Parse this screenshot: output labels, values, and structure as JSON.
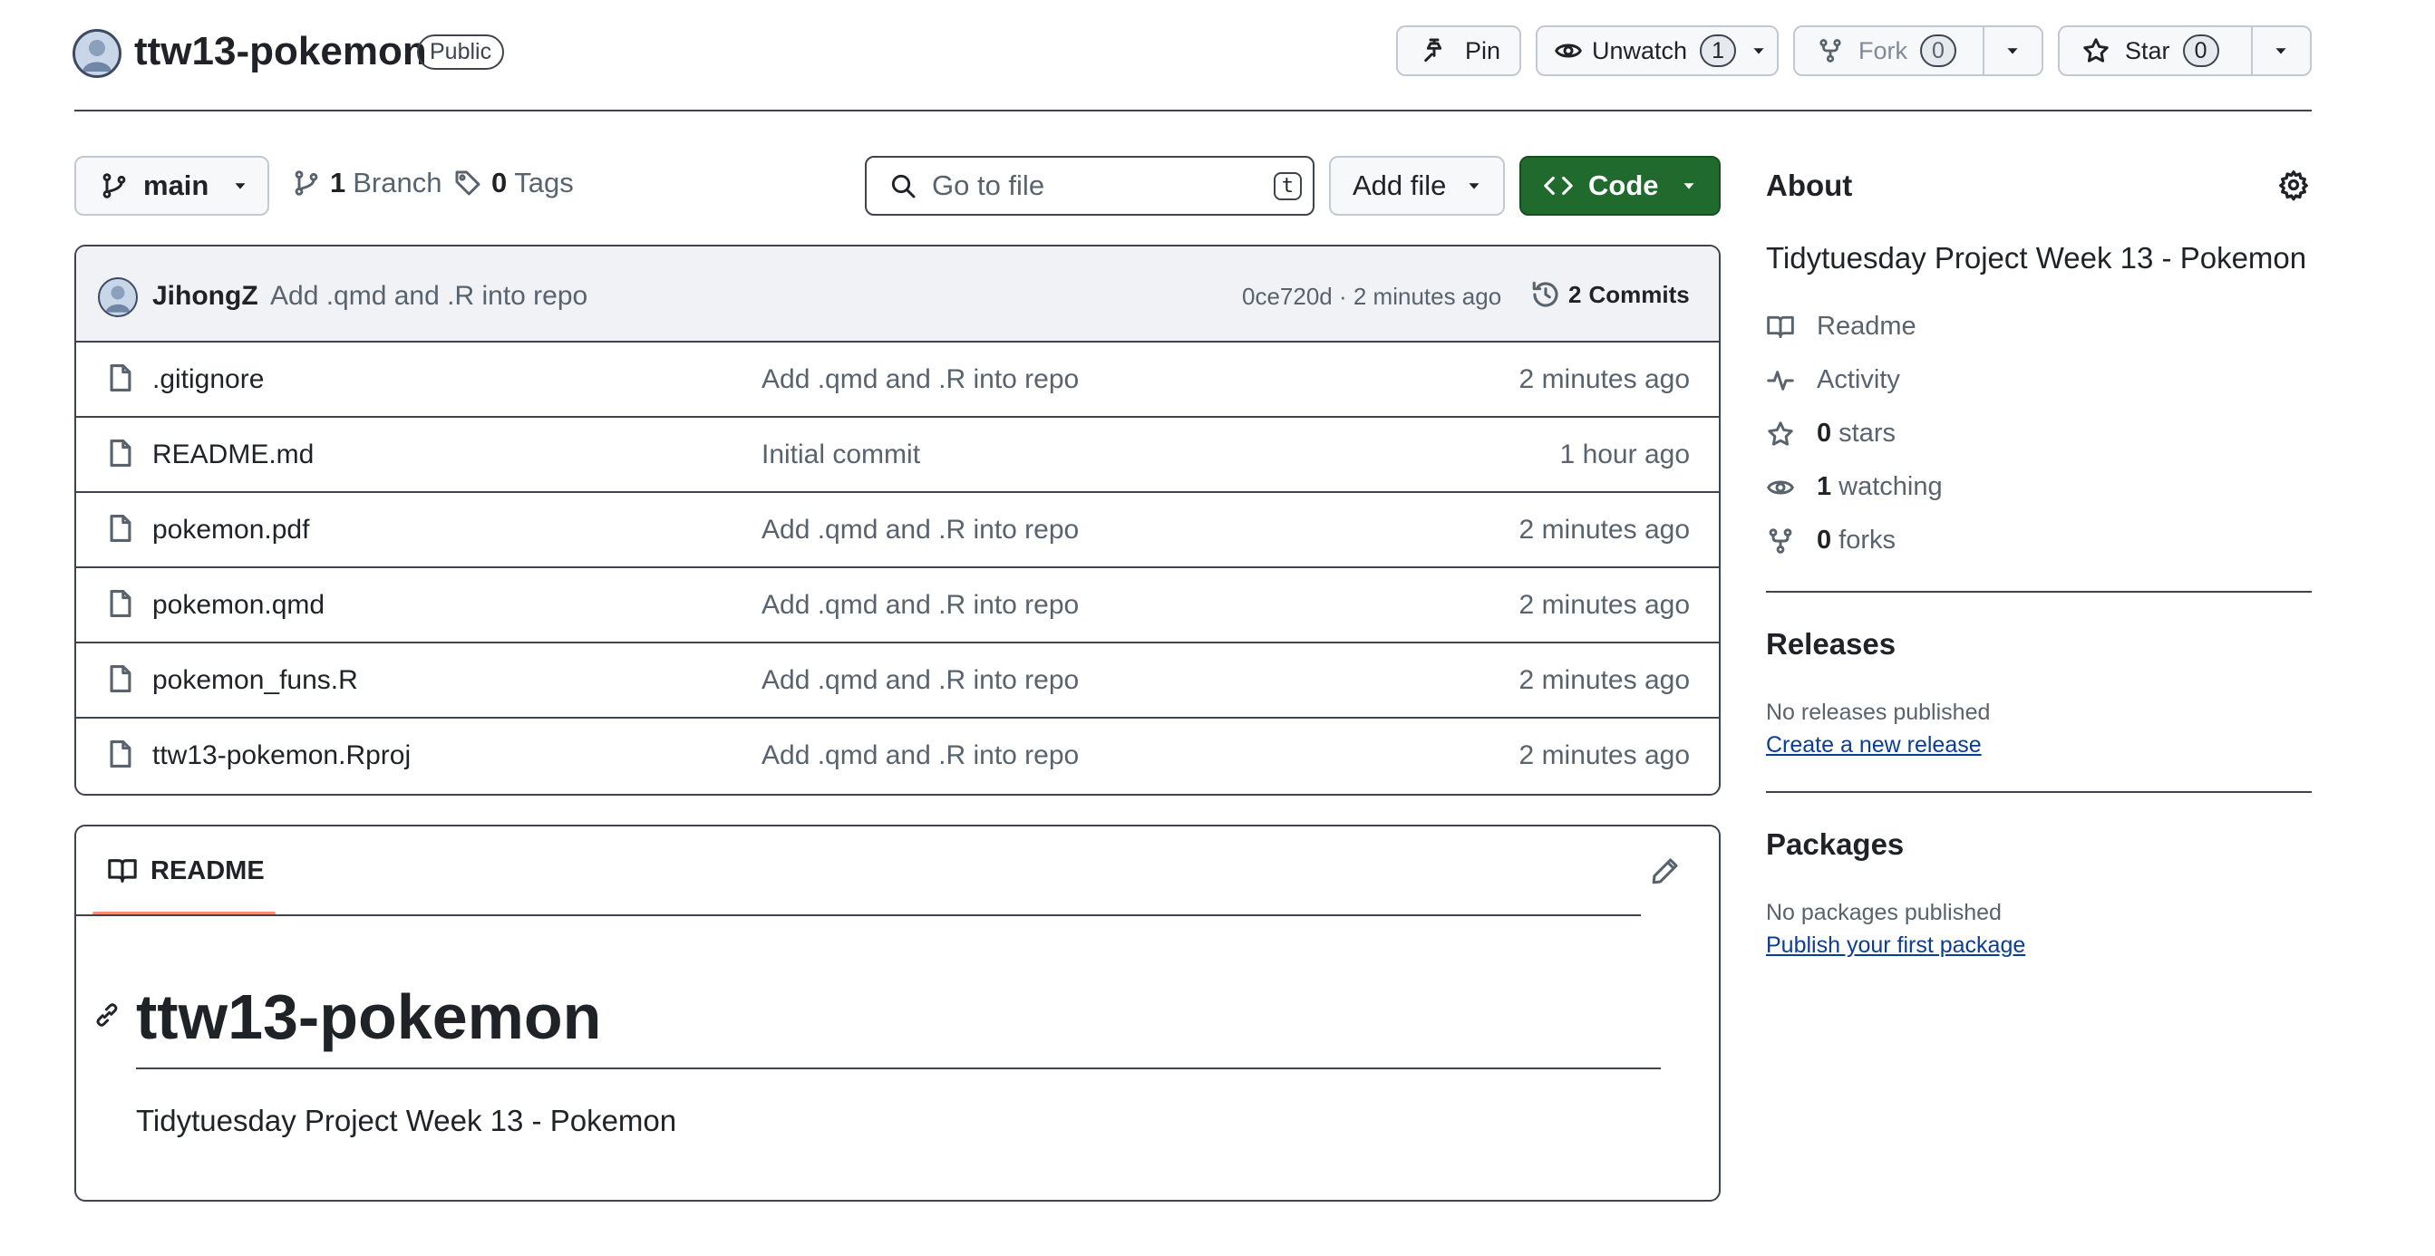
{
  "repo": {
    "name": "ttw13-pokemon",
    "visibility": "Public"
  },
  "actions": {
    "pin_label": "Pin",
    "unwatch_label": "Unwatch",
    "watch_count": "1",
    "fork_label": "Fork",
    "fork_count": "0",
    "star_label": "Star",
    "star_count": "0"
  },
  "toolbar": {
    "branch": "main",
    "branches_count": "1",
    "branches_label": "Branch",
    "tags_count": "0",
    "tags_label": "Tags",
    "search_placeholder": "Go to file",
    "search_shortcut": "t",
    "add_file_label": "Add file",
    "code_label": "Code"
  },
  "latest_commit": {
    "author": "JihongZ",
    "message": "Add .qmd and .R into repo",
    "hash_time": "0ce720d · 2 minutes ago",
    "commits_count": "2",
    "commits_label": "Commits"
  },
  "files": [
    {
      "name": ".gitignore",
      "message": "Add .qmd and .R into repo",
      "time": "2 minutes ago"
    },
    {
      "name": "README.md",
      "message": "Initial commit",
      "time": "1 hour ago"
    },
    {
      "name": "pokemon.pdf",
      "message": "Add .qmd and .R into repo",
      "time": "2 minutes ago"
    },
    {
      "name": "pokemon.qmd",
      "message": "Add .qmd and .R into repo",
      "time": "2 minutes ago"
    },
    {
      "name": "pokemon_funs.R",
      "message": "Add .qmd and .R into repo",
      "time": "2 minutes ago"
    },
    {
      "name": "ttw13-pokemon.Rproj",
      "message": "Add .qmd and .R into repo",
      "time": "2 minutes ago"
    }
  ],
  "readme": {
    "tab_label": "README",
    "heading": "ttw13-pokemon",
    "body": "Tidytuesday Project Week 13 - Pokemon"
  },
  "about": {
    "heading": "About",
    "description": "Tidytuesday Project Week 13 - Pokemon",
    "readme_label": "Readme",
    "activity_label": "Activity",
    "stars_count": "0",
    "stars_label": "stars",
    "watching_count": "1",
    "watching_label": "watching",
    "forks_count": "0",
    "forks_label": "forks"
  },
  "releases": {
    "heading": "Releases",
    "empty_text": "No releases published",
    "create_link": "Create a new release"
  },
  "packages": {
    "heading": "Packages",
    "empty_text": "No packages published",
    "publish_link": "Publish your first package"
  },
  "icons": {
    "pin": "pin-icon",
    "eye": "eye-icon",
    "fork": "repo-forked-icon",
    "star": "star-icon",
    "branch": "git-branch-icon",
    "tag": "tag-icon",
    "search": "search-icon",
    "code": "code-icon",
    "history": "history-icon",
    "file": "file-icon",
    "book": "book-icon",
    "pulse": "pulse-icon",
    "gear": "gear-icon",
    "pencil": "pencil-icon",
    "link": "link-icon",
    "caret": "triangle-down-icon"
  },
  "colors": {
    "code_button": "#1f6a2c",
    "readme_tab_underline": "#fd8c73",
    "link": "#0b3d91"
  }
}
